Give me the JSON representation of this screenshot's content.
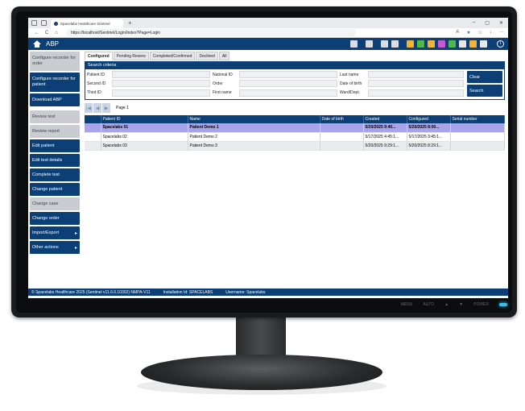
{
  "browser": {
    "tab_title": "Spacelabs Healthcare Sentinel",
    "url": "https://localhost/Sentinel/Login/Index?Page=Login",
    "new_tab": "+",
    "win_min": "–",
    "win_max": "▢",
    "win_close": "✕",
    "back": "←",
    "refresh": "C",
    "home": "⌂"
  },
  "app": {
    "title": "ABP"
  },
  "sidebar": {
    "items": [
      {
        "label": "Configure recorder for order",
        "enabled": false
      },
      {
        "label": "Configure recorder for patient",
        "enabled": true
      },
      {
        "label": "Download ABP",
        "enabled": true
      },
      {
        "label": "Review test",
        "enabled": false
      },
      {
        "label": "Review report",
        "enabled": false
      },
      {
        "label": "Edit patient",
        "enabled": true
      },
      {
        "label": "Edit test details",
        "enabled": true
      },
      {
        "label": "Complete test",
        "enabled": true
      },
      {
        "label": "Change patient",
        "enabled": true
      },
      {
        "label": "Change case",
        "enabled": false
      },
      {
        "label": "Change order",
        "enabled": true
      },
      {
        "label": "Import/Export",
        "enabled": true
      },
      {
        "label": "Other actions",
        "enabled": true
      }
    ]
  },
  "tabs": [
    "Configured",
    "Pending Review",
    "Completed/Confirmed",
    "Declined",
    "All"
  ],
  "search": {
    "title": "Search criteria",
    "labels": {
      "patient_id": "Patient ID",
      "national_id": "National ID",
      "last_name": "Last name",
      "second_id": "Second ID",
      "order": "Order",
      "date_of_birth": "Date of birth",
      "third_id": "Third ID",
      "first_name": "First name",
      "ward": "Ward/Dept."
    },
    "clear_label": "Clear",
    "search_label": "Search"
  },
  "pager": {
    "label": "Page 1",
    "first": "|◀",
    "prev": "◀",
    "next": "▶"
  },
  "table": {
    "columns": [
      "",
      "Patient ID",
      "Name",
      "Date of birth",
      "Created",
      "Configured",
      "Serial number"
    ],
    "rows": [
      {
        "patient_id": "Spacelabs 01",
        "name": "Patient Demo 1",
        "dob": "",
        "created": "5/20/2025 9:40...",
        "configured": "5/20/2025 8:00...",
        "serial": "",
        "selected": true
      },
      {
        "patient_id": "Spacelabs 02",
        "name": "Patient Demo 2",
        "dob": "",
        "created": "5/17/2025 4:45:1...",
        "configured": "5/17/2025 3:45:1...",
        "serial": "",
        "selected": false
      },
      {
        "patient_id": "Spacelabs 03",
        "name": "Patient Demo 3",
        "dob": "",
        "created": "5/20/2025 9:29:1...",
        "configured": "5/20/2025 8:29:1...",
        "serial": "",
        "selected": false
      }
    ]
  },
  "status": {
    "copyright": "© Spacelabs Healthcare 2025 (Sentinel v11.6.0.10302) NMPA-V11",
    "installation": "Installation Id: SPACELABS",
    "username": "Username: Spacelabs"
  },
  "monitor": {
    "buttons": [
      "MENU",
      "AUTO",
      "▲",
      "▼",
      "POWER"
    ]
  }
}
